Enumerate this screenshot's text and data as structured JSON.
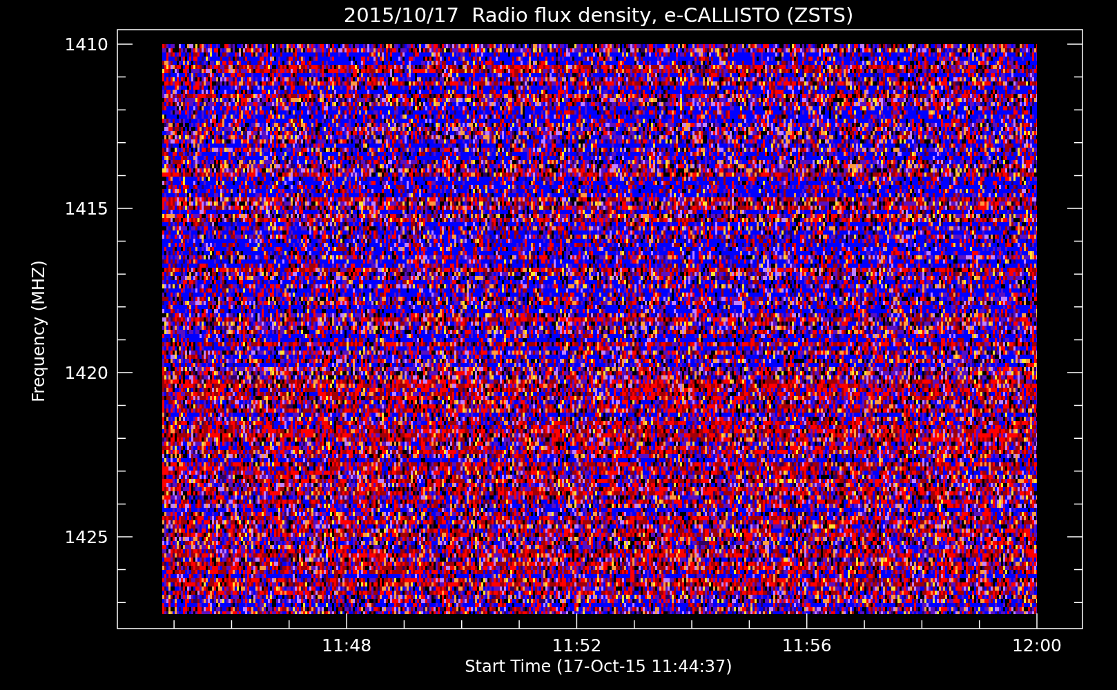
{
  "title": "2015/10/17  Radio flux density, e-CALLISTO (ZSTS)",
  "y_axis": {
    "label": "Frequency (MHZ)",
    "ticks": [
      "1410",
      "1415",
      "1420",
      "1425"
    ]
  },
  "x_axis": {
    "label": "Start Time (17-Oct-15 11:44:37)",
    "ticks": [
      "11:48",
      "11:52",
      "11:56",
      "12:00"
    ]
  }
}
